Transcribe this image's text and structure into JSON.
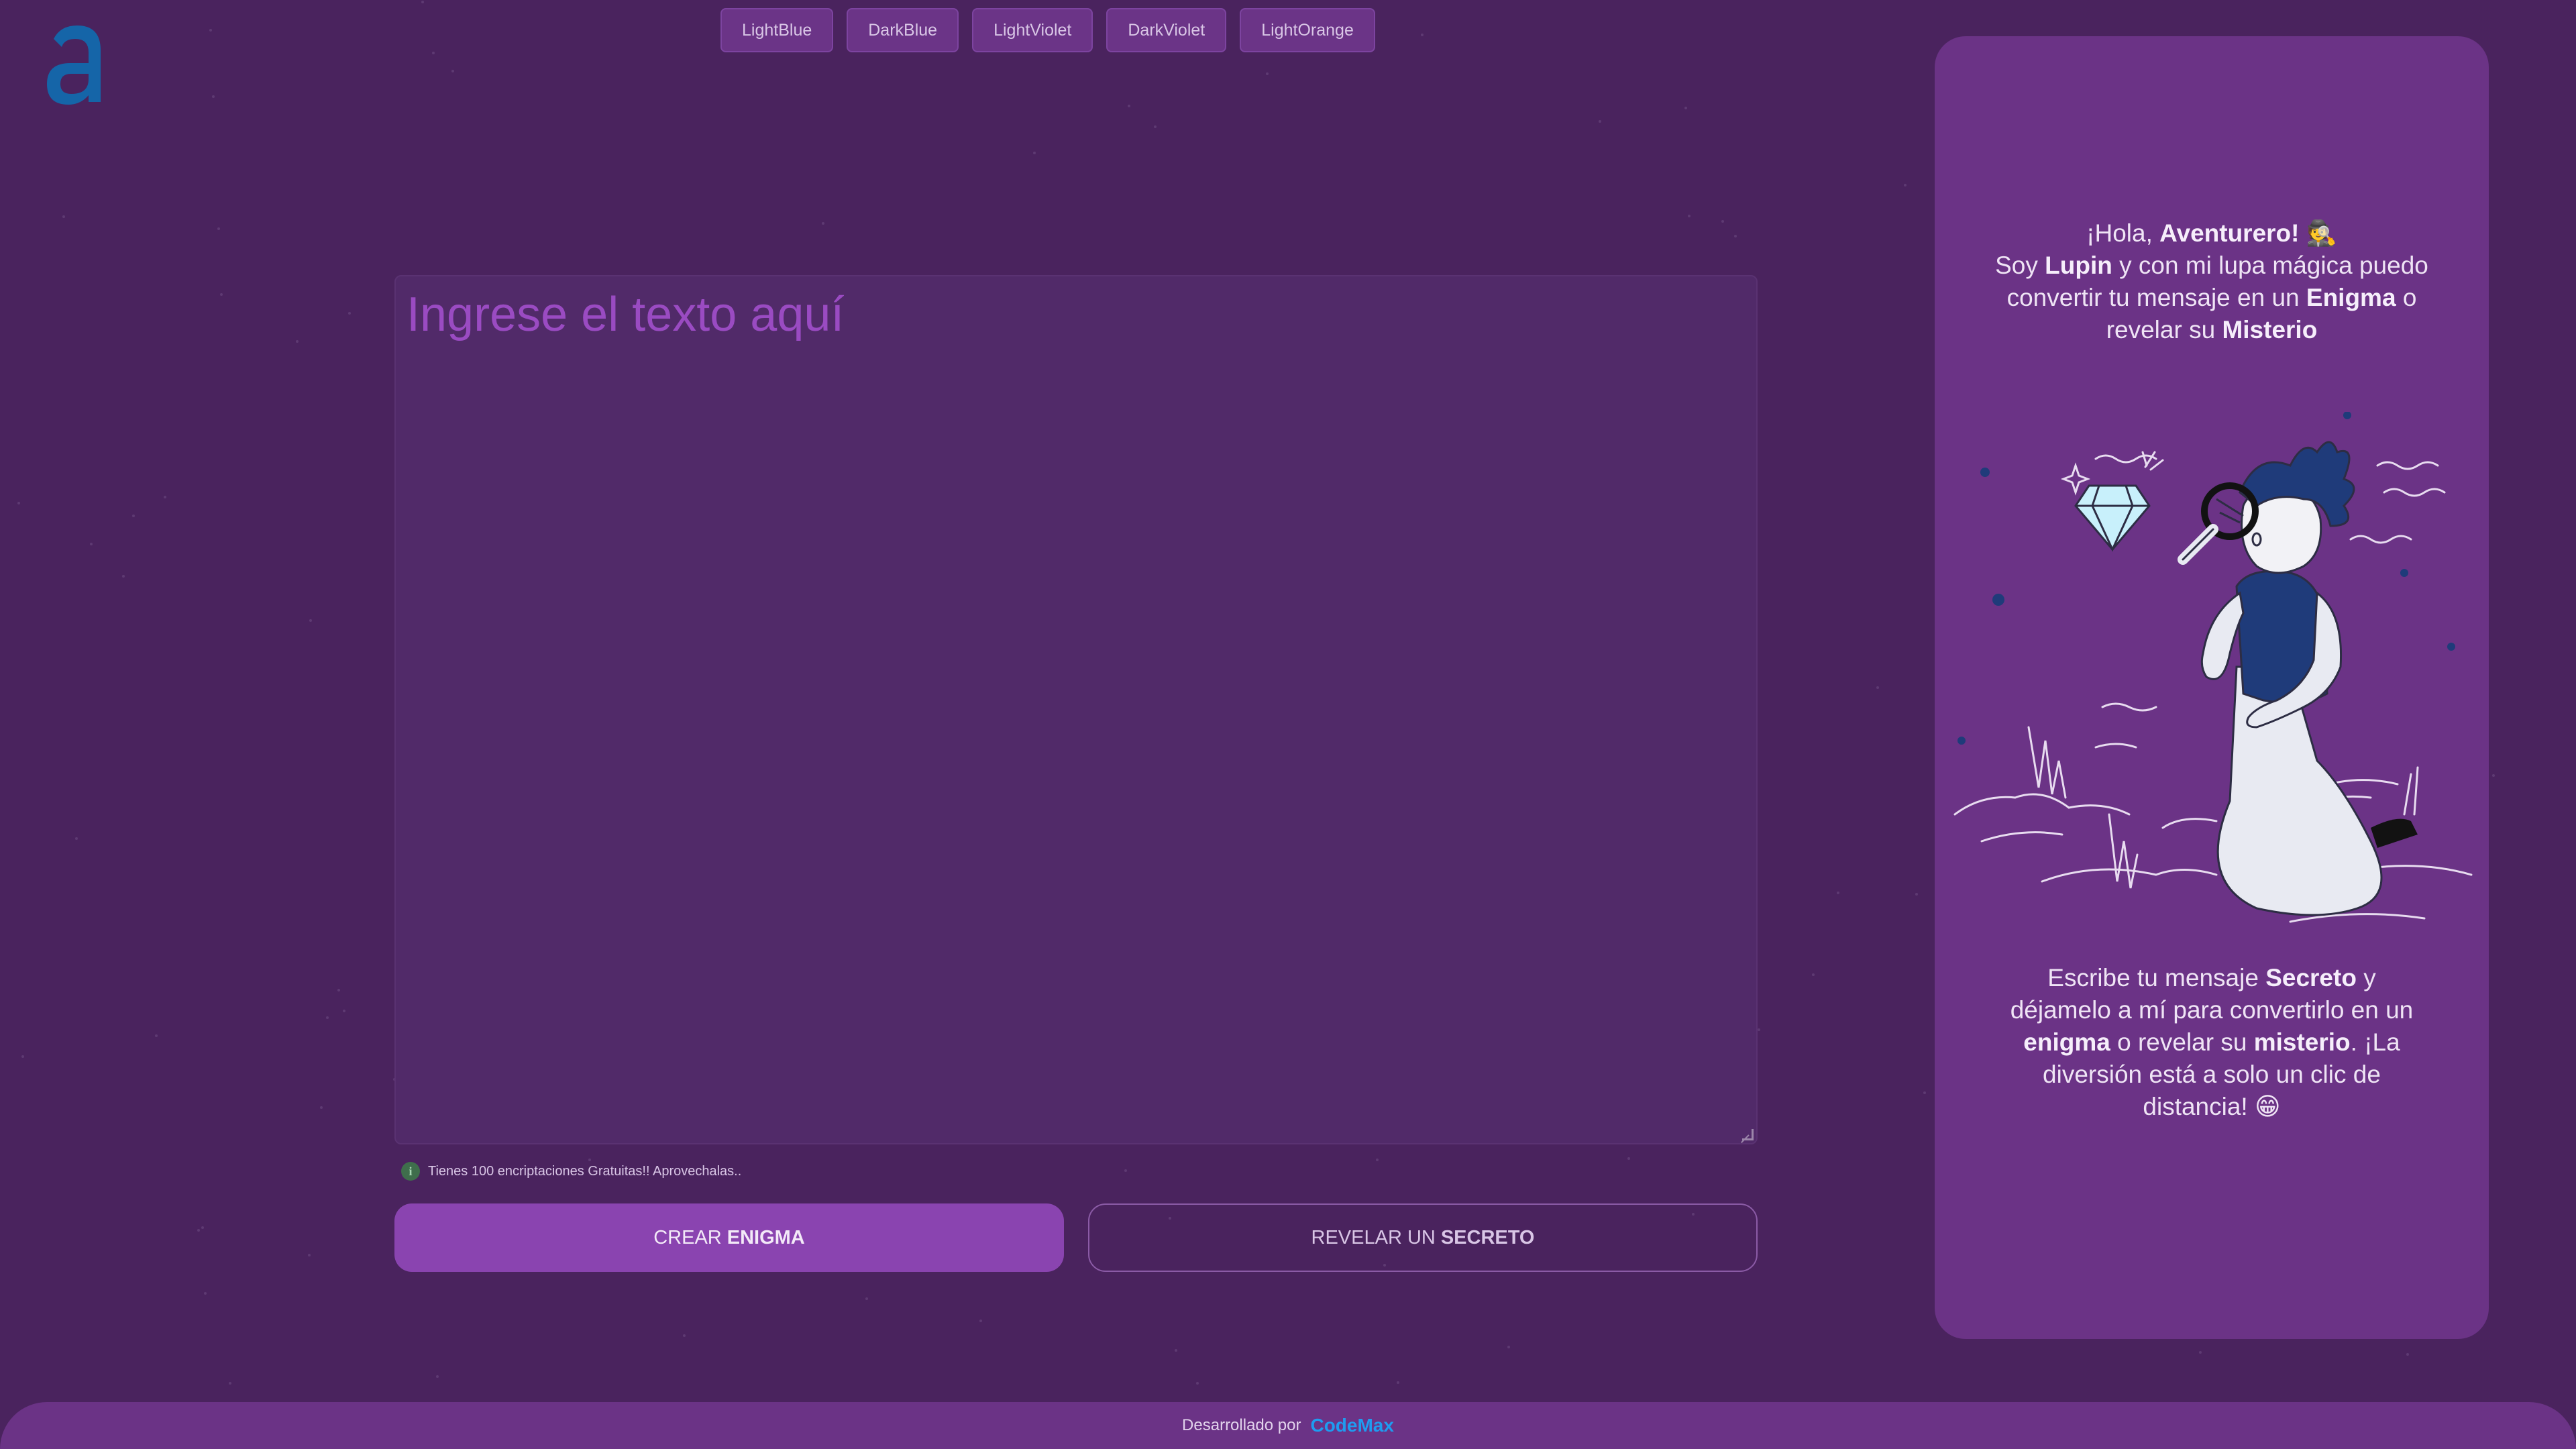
{
  "theme_buttons": [
    "LightBlue",
    "DarkBlue",
    "LightViolet",
    "DarkViolet",
    "LightOrange"
  ],
  "editor": {
    "placeholder": "Ingrese el texto aquí"
  },
  "info": {
    "text": "Tienes 100 encriptaciones Gratuitas!! Aprovechalas..",
    "icon": "i"
  },
  "actions": {
    "encrypt_prefix": "CREAR",
    "encrypt_strong": "ENIGMA",
    "decrypt_prefix": "REVELAR UN",
    "decrypt_strong": "SECRETO"
  },
  "side": {
    "greet_1": "¡Hola,",
    "greet_name": "Aventurero!",
    "greet_emoji": "🕵️",
    "intro_1": "Soy",
    "intro_name": "Lupin",
    "intro_2": "y con mi lupa mágica puedo convertir tu mensaje en un",
    "intro_enigma": "Enigma",
    "intro_3": "o revelar su",
    "intro_misterio": "Misterio",
    "outro_1": "Escribe tu mensaje",
    "outro_secreto": "Secreto",
    "outro_2": "y déjamelo a mí para convertirlo en un",
    "outro_enigma": "enigma",
    "outro_3": "o revelar su",
    "outro_misterio": "misterio",
    "outro_4": ". ¡La diversión está a solo un clic de distancia!",
    "outro_emoji": "😁"
  },
  "footer": {
    "text": "Desarrollado por",
    "brand": "CodeMax"
  },
  "colors": {
    "background": "#4a235e",
    "card": "#6b3386",
    "accent": "#8a44b0",
    "brand": "#1e9cf0",
    "logo": "#1565a8"
  }
}
